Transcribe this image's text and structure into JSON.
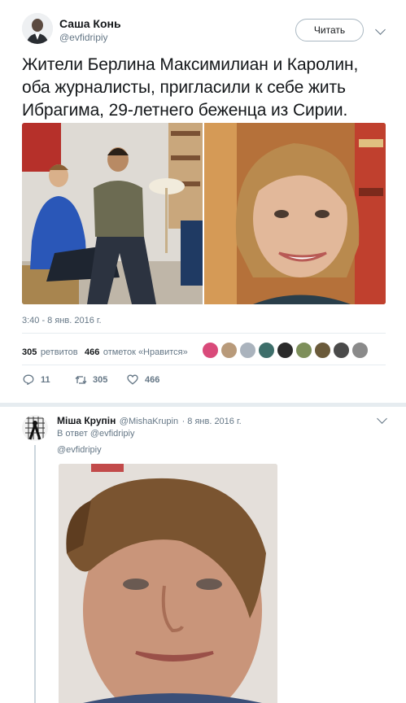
{
  "tweet": {
    "author_name": "Саша Конь",
    "author_handle": "@evfidripiy",
    "follow_label": "Читать",
    "text": "Жители Берлина Максимилиан и Каролин, оба журналисты, пригласили к себе жить Ибрагима, 29-летнего беженца из Сирии.",
    "timestamp": "3:40 - 8 янв. 2016 г.",
    "retweets_count": "305",
    "retweets_label": "ретвитов",
    "likes_count": "466",
    "likes_label": "отметок «Нравится»",
    "actions": {
      "reply_count": "11",
      "retweet_count": "305",
      "like_count": "466"
    }
  },
  "reply": {
    "author_name": "Міша Крупін",
    "author_handle": "@MishaKrupin",
    "date": "· 8 янв. 2016 г.",
    "in_reply_to_prefix": "В ответ",
    "in_reply_to_handle": "@evfidripiy",
    "mention": "@evfidripiy"
  },
  "colors": {
    "text": "#14171a",
    "muted": "#657786",
    "divider": "#e6ecf0"
  }
}
